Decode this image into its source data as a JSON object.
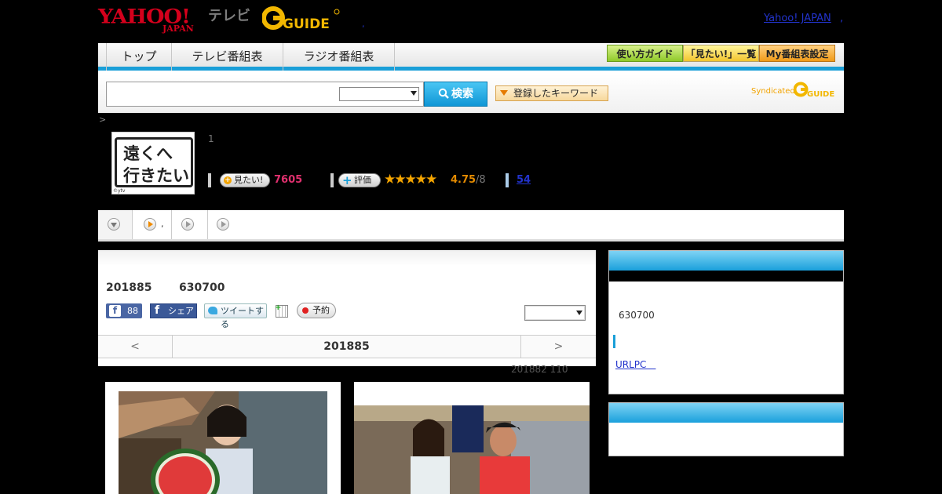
{
  "header": {
    "yahoo_logo": "YAHOO!",
    "yahoo_japan": "JAPAN",
    "tv_label": "テレビ",
    "gguide_logo": "GUIDE",
    "top_link": "Yahoo! JAPAN",
    "top_dot": ",",
    "small_dot": ","
  },
  "nav": {
    "tabs": [
      {
        "label": "トップ"
      },
      {
        "label": "テレビ番組表"
      },
      {
        "label": "ラジオ番組表"
      }
    ],
    "buttons": [
      {
        "label": "使い方ガイド"
      },
      {
        "label": "「見たい!」一覧"
      },
      {
        "label": "My番組表設定"
      }
    ],
    "search_button": "検索",
    "keyword_button": "登録したキーワード",
    "syndicated": "Syndicated"
  },
  "breadcrumb": ">",
  "program": {
    "thumb_line1": "遠くへ",
    "thumb_line2": "行きたい",
    "thumb_copyright": "©ytv",
    "number": "1",
    "want_label": "見たい!",
    "want_count": "7605",
    "rate_label": "評価",
    "stars": "★★★★★",
    "rating": 4.75,
    "score": "4.75",
    "score_den": "/8",
    "comment_count": "54"
  },
  "subtabs": [
    {
      "label": ""
    },
    {
      "label": ","
    },
    {
      "label": ""
    },
    {
      "label": ""
    }
  ],
  "episode": {
    "date": "201885",
    "id": "630700",
    "fb_like": "f",
    "fb_count": "88",
    "fb_share": "シェア",
    "fb_share_icon": "f",
    "tweet": "ツイートする",
    "reserve": "予約",
    "cal_plus": "+",
    "pager_prev": "<",
    "pager_title": "201885",
    "pager_next": ">",
    "footer": "201882  110"
  },
  "sidebar": {
    "id": "630700",
    "link": "URLPC　"
  },
  "colors": {
    "accent_blue": "#1a9fd8",
    "want_pink": "#e0306e",
    "score_orange": "#e38a00",
    "yahoo_red": "#d4001c"
  }
}
